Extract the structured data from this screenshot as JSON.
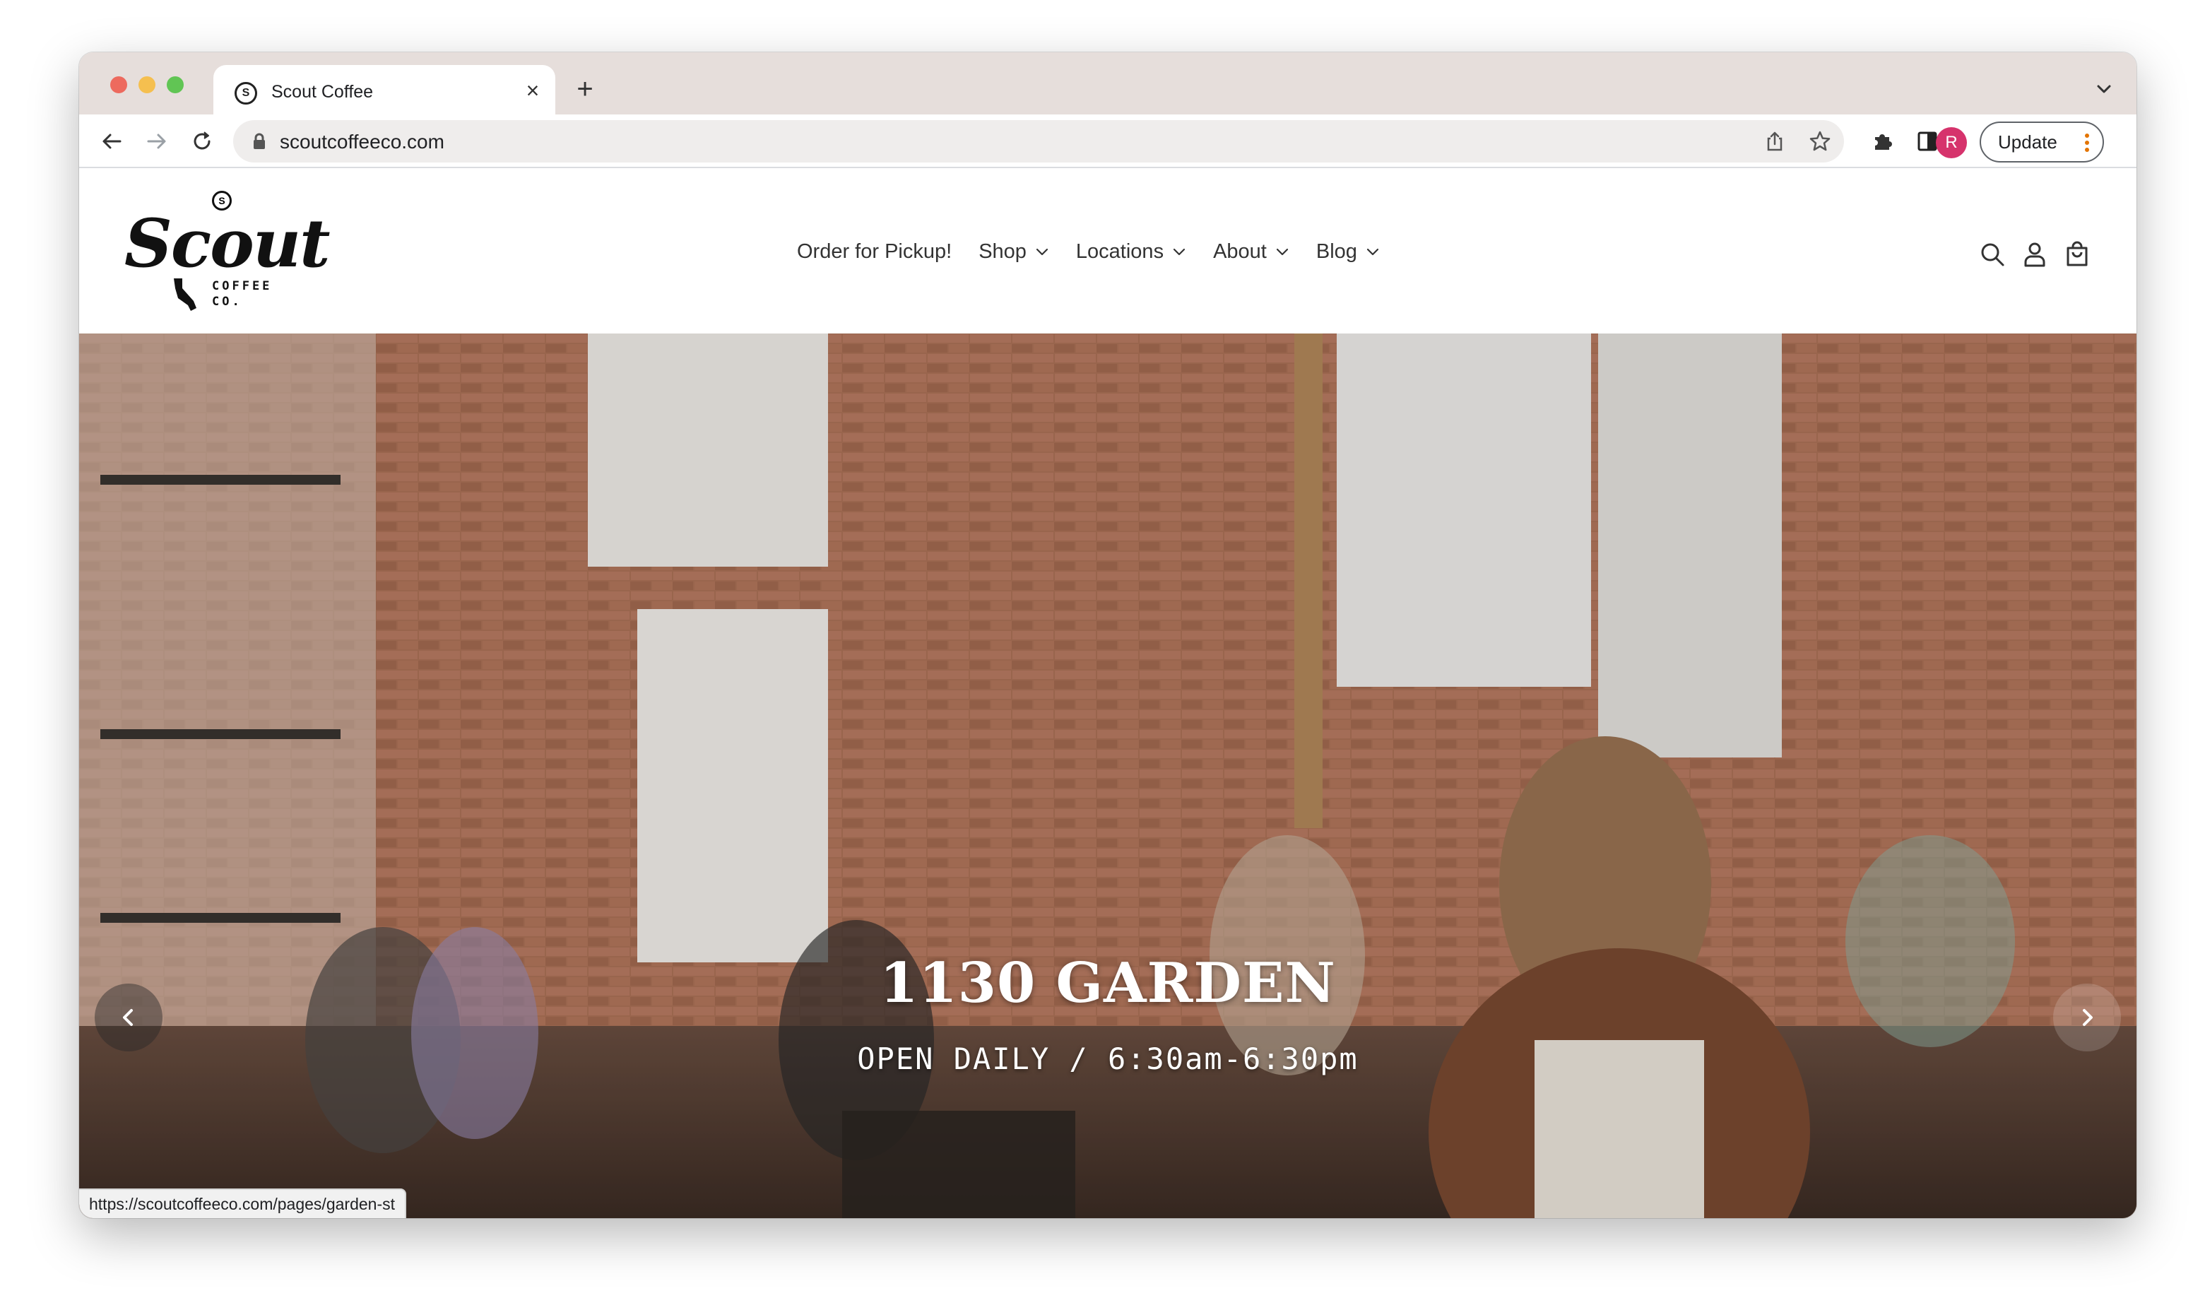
{
  "browser": {
    "tab_title": "Scout Coffee",
    "url": "scoutcoffeeco.com",
    "profile_initial": "R",
    "update_label": "Update",
    "status_url": "https://scoutcoffeeco.com/pages/garden-st"
  },
  "site": {
    "logo": {
      "wordmark": "Scout",
      "badge": "S",
      "sub_line1": "COFFEE",
      "sub_line2": "CO."
    },
    "nav": [
      {
        "label": "Order for Pickup!",
        "has_dropdown": false
      },
      {
        "label": "Shop",
        "has_dropdown": true
      },
      {
        "label": "Locations",
        "has_dropdown": true
      },
      {
        "label": "About",
        "has_dropdown": true
      },
      {
        "label": "Blog",
        "has_dropdown": true
      }
    ],
    "header_icons": [
      "search-icon",
      "account-icon",
      "cart-icon"
    ]
  },
  "hero": {
    "title": "1130 GARDEN",
    "subtitle": "OPEN DAILY / 6:30am-6:30pm"
  },
  "colors": {
    "tabstrip": "#e6dedb",
    "avatar": "#d6336c",
    "traffic_red": "#ed6a5e",
    "traffic_yellow": "#f5bf4f",
    "traffic_green": "#61c554"
  }
}
